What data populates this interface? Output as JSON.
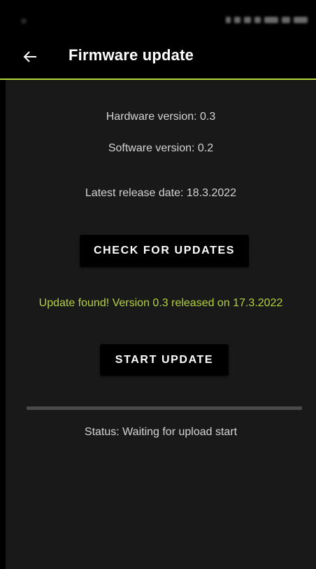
{
  "app_bar": {
    "title": "Firmware update",
    "back_icon": "arrow-left-icon"
  },
  "info": {
    "hardware_version": "Hardware version: 0.3",
    "software_version": "Software version: 0.2",
    "latest_release_date": "Latest release date: 18.3.2022"
  },
  "actions": {
    "check_label": "CHECK FOR UPDATES",
    "start_label": "START UPDATE"
  },
  "update_message": "Update found! Version 0.3 released on 17.3.2022",
  "progress": {
    "fraction": 0
  },
  "status_text": "Status: Waiting for upload start",
  "colors": {
    "accent": "#b5d63a",
    "background": "#191919",
    "app_bar": "#000000",
    "button": "#000000"
  }
}
